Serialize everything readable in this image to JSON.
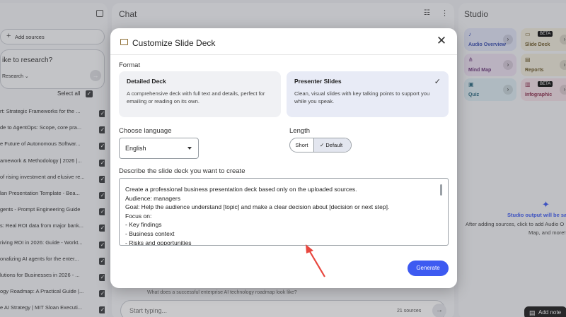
{
  "sources": {
    "add_label": "Add sources",
    "research_prompt": "ike to research?",
    "research_mode": "Research",
    "select_all": "Select all",
    "items": [
      "rt: Strategic Frameworks for the ...",
      "de to AgentOps: Scope, core pra...",
      "e Future of Autonomous Softwar...",
      "amework & Methodology | 2026 |...",
      "of rising investment and elusive re...",
      "lan Presentation Template - Bea...",
      "gents - Prompt Engineering Guide",
      "s: Real ROI data from major bank...",
      "riving ROI in 2026: Guide - Workt...",
      "onalizing AI agents for the enter...",
      "lutions for Businesses in 2026 - ...",
      "ogy Roadmap: A Practical Guide |...",
      "e AI Strategy | MIT Sloan Executi..."
    ]
  },
  "chat": {
    "title": "Chat",
    "input_placeholder": "Start typing...",
    "source_count": "21 sources",
    "peek_text": "What does a successful enterprise AI technology roadmap look like?"
  },
  "studio": {
    "title": "Studio",
    "cards": [
      {
        "name": "Audio Overview",
        "color": "#dfe3f6",
        "text": "#3b4fb0",
        "icon": "audio-icon"
      },
      {
        "name": "Slide Deck",
        "color": "#efeadb",
        "text": "#6c5a2a",
        "icon": "slides-icon",
        "beta": "BETA"
      },
      {
        "name": "Mind Map",
        "color": "#ebdff0",
        "text": "#6b3a7a",
        "icon": "mindmap-icon"
      },
      {
        "name": "Reports",
        "color": "#efeadb",
        "text": "#6c5a2a",
        "icon": "reports-icon"
      },
      {
        "name": "Quiz",
        "color": "#dcebf1",
        "text": "#2d6a80",
        "icon": "quiz-icon"
      },
      {
        "name": "Infographic",
        "color": "#f1e0e6",
        "text": "#8a2e4d",
        "icon": "infographic-icon",
        "beta": "BETA"
      }
    ],
    "empty_title": "Studio output will be sav",
    "empty_body_1": "After adding sources, click to add Audio O",
    "empty_body_2": "Map, and more!",
    "add_note": "Add note"
  },
  "modal": {
    "title": "Customize Slide Deck",
    "format_label": "Format",
    "formats": [
      {
        "title": "Detailed Deck",
        "desc": "A comprehensive deck with full text and details, perfect for emailing or reading on its own.",
        "selected": false
      },
      {
        "title": "Presenter Slides",
        "desc": "Clean, visual slides with key talking points to support you while you speak.",
        "selected": true
      }
    ],
    "language_label": "Choose language",
    "language_value": "English",
    "length_label": "Length",
    "length_options": [
      "Short",
      "Default"
    ],
    "length_selected": "Default",
    "describe_label": "Describe the slide deck you want to create",
    "describe_lines": [
      "Create a professional business presentation deck based only on the uploaded sources.",
      "Audience:  managers",
      "Goal: Help the audience understand [topic] and make a clear decision about [decision or next step].",
      "Focus on:",
      "- Key findings",
      "- Business context",
      "- Risks and opportunities"
    ],
    "generate_label": "Generate"
  },
  "accent": "#3d5af1",
  "annotation_arrow_color": "#e8473f"
}
